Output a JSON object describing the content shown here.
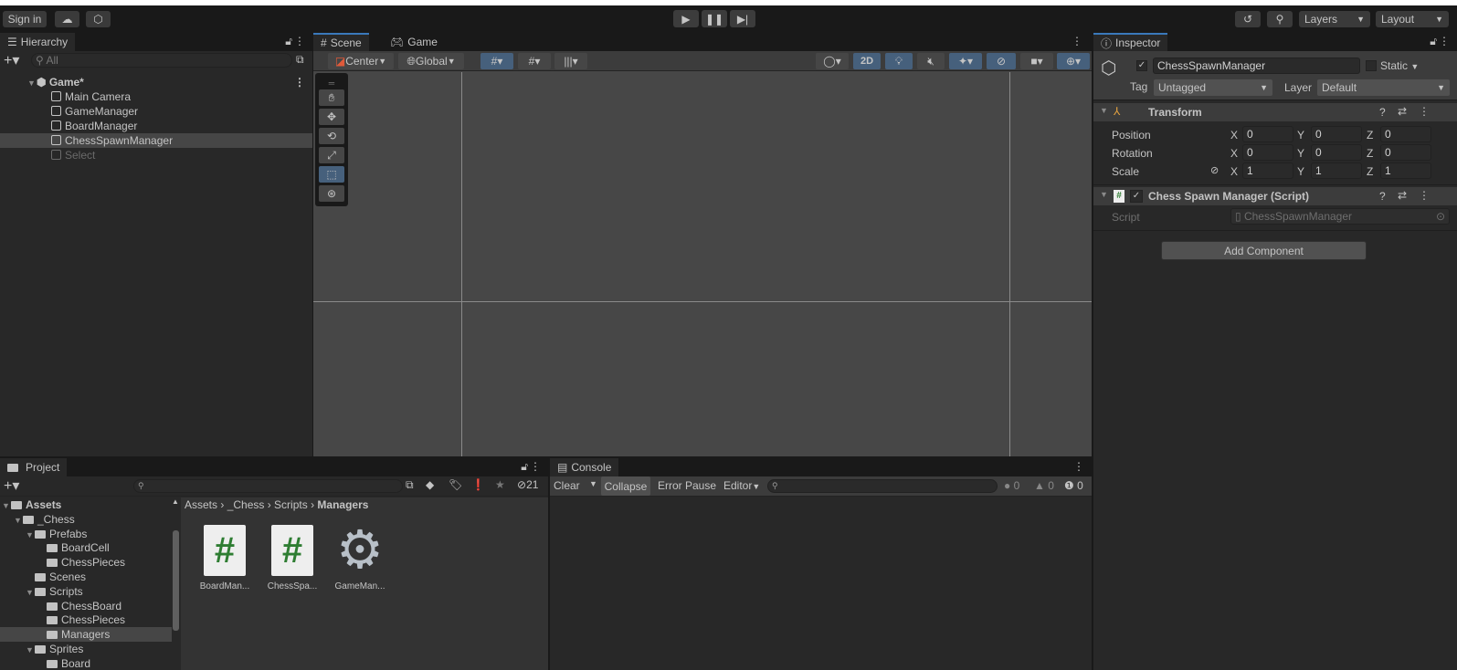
{
  "toolbar": {
    "sign_in": "Sign in",
    "cloud_icon": "cloud-icon",
    "collab_icon": "collab-icon",
    "play_icon": "play-icon",
    "pause_icon": "pause-icon",
    "step_icon": "step-icon",
    "history_icon": "history-icon",
    "search_icon": "search-icon",
    "layers": "Layers",
    "layout": "Layout"
  },
  "hierarchy": {
    "tab": "Hierarchy",
    "search_placeholder": "All",
    "scene": "Game*",
    "items": [
      "Main Camera",
      "GameManager",
      "BoardManager",
      "ChessSpawnManager",
      "Select"
    ],
    "selected": "ChessSpawnManager"
  },
  "scene": {
    "tabs": [
      "Scene",
      "Game"
    ],
    "active_tab": "Scene",
    "pivot": "Center",
    "space": "Global",
    "mode_2d": "2D"
  },
  "inspector": {
    "tab": "Inspector",
    "object_name": "ChessSpawnManager",
    "active": true,
    "static_label": "Static",
    "tag_label": "Tag",
    "tag": "Untagged",
    "layer_label": "Layer",
    "layer": "Default",
    "transform": {
      "title": "Transform",
      "rows": [
        {
          "label": "Position",
          "x": "0",
          "y": "0",
          "z": "0"
        },
        {
          "label": "Rotation",
          "x": "0",
          "y": "0",
          "z": "0"
        },
        {
          "label": "Scale",
          "x": "1",
          "y": "1",
          "z": "1"
        }
      ]
    },
    "script_component": {
      "title": "Chess Spawn Manager (Script)",
      "enabled": true,
      "script_label": "Script",
      "script_value": "ChessSpawnManager"
    },
    "add_component": "Add Component"
  },
  "project": {
    "tab": "Project",
    "hidden_count": "21",
    "tree": [
      {
        "label": "Assets",
        "depth": 0,
        "open": true,
        "bold": true
      },
      {
        "label": "_Chess",
        "depth": 1,
        "open": true
      },
      {
        "label": "Prefabs",
        "depth": 2,
        "open": true
      },
      {
        "label": "BoardCell",
        "depth": 3
      },
      {
        "label": "ChessPieces",
        "depth": 3
      },
      {
        "label": "Scenes",
        "depth": 2
      },
      {
        "label": "Scripts",
        "depth": 2,
        "open": true
      },
      {
        "label": "ChessBoard",
        "depth": 3
      },
      {
        "label": "ChessPieces",
        "depth": 3
      },
      {
        "label": "Managers",
        "depth": 3,
        "selected": true
      },
      {
        "label": "Sprites",
        "depth": 2,
        "open": true
      },
      {
        "label": "Board",
        "depth": 3
      }
    ],
    "breadcrumb": [
      "Assets",
      "_Chess",
      "Scripts",
      "Managers"
    ],
    "assets": [
      {
        "label": "BoardMan...",
        "icon": "csharp-script-icon"
      },
      {
        "label": "ChessSpa...",
        "icon": "csharp-script-icon"
      },
      {
        "label": "GameMan...",
        "icon": "gear-icon"
      }
    ]
  },
  "console": {
    "tab": "Console",
    "clear": "Clear",
    "collapse": "Collapse",
    "error_pause": "Error Pause",
    "editor": "Editor",
    "log_count": "0",
    "warning_count": "0",
    "error_count": "0"
  },
  "colors": {
    "accent": "#46607c",
    "script_green": "#2e7d32"
  }
}
